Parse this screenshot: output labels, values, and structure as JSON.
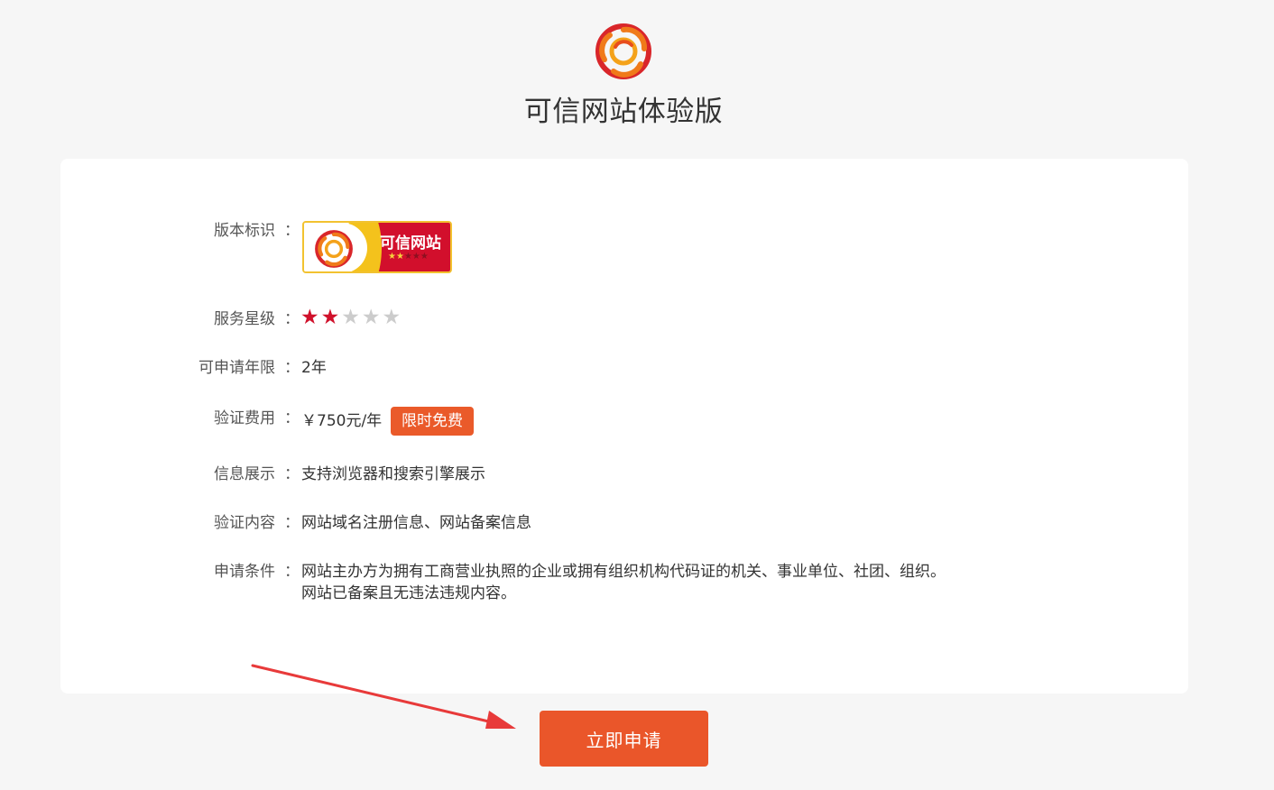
{
  "header": {
    "title": "可信网站体验版",
    "logo_icon": "orange-ring-logo-icon"
  },
  "colors": {
    "accent": "#ea562a",
    "star_active": "#d0112b",
    "star_inactive": "#cccccc",
    "badge_red": "#d20f2c",
    "badge_yellow": "#f4c21c",
    "arrow": "#e83a3a"
  },
  "details": {
    "version_badge": {
      "label": "版本标识",
      "badge_text": "可信网站",
      "badge_stars_filled": 2,
      "badge_stars_total": 5
    },
    "service_level": {
      "label": "服务星级",
      "stars_filled": 2,
      "stars_total": 5
    },
    "term": {
      "label": "可申请年限",
      "value": "2年"
    },
    "fee": {
      "label": "验证费用",
      "value": "￥750元/年",
      "tag": "限时免费"
    },
    "display": {
      "label": "信息展示",
      "value": "支持浏览器和搜索引擎展示"
    },
    "content": {
      "label": "验证内容",
      "value": "网站域名注册信息、网站备案信息"
    },
    "conditions": {
      "label": "申请条件",
      "line1": "网站主办方为拥有工商营业执照的企业或拥有组织机构代码证的机关、事业单位、社团、组织。",
      "line2": "网站已备案且无违法违规内容。"
    },
    "colon": "："
  },
  "actions": {
    "apply_label": "立即申请"
  }
}
